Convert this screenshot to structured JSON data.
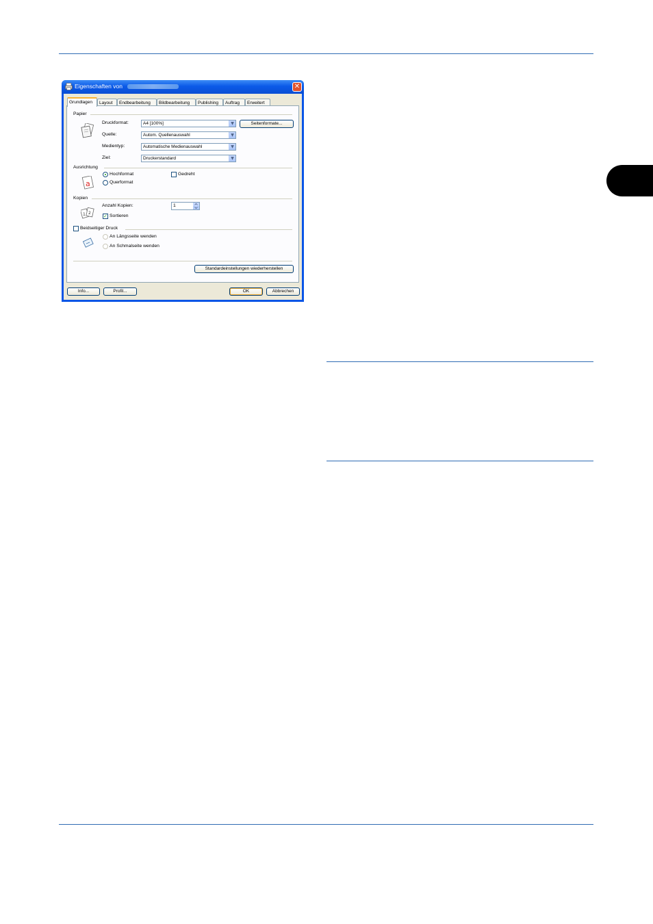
{
  "dialog": {
    "title": "Eigenschaften von",
    "close_glyph": "✕",
    "title_icon": "printer-icon",
    "tabs": [
      "Grundlagen",
      "Layout",
      "Endbearbeitung",
      "Bildbearbeitung",
      "Publishing",
      "Auftrag",
      "Erweitert"
    ],
    "active_tab": "Grundlagen",
    "papier": {
      "heading": "Papier",
      "druckformat_label": "Druckformat:",
      "druckformat_value": "A4  [100%]",
      "quelle_label": "Quelle:",
      "quelle_value": "Autom. Quellenauswahl",
      "medientyp_label": "Medientyp:",
      "medientyp_value": "Automatische Medienauswahl",
      "ziel_label": "Ziel:",
      "ziel_value": "Druckerstandard",
      "seitenformate_button": "Seitenformate..."
    },
    "ausrichtung": {
      "heading": "Ausrichtung",
      "hochformat": "Hochformat",
      "querformat": "Querformat",
      "gedreht": "Gedreht",
      "selected": "Hochformat"
    },
    "kopien": {
      "heading": "Kopien",
      "anzahl_label": "Anzahl Kopien:",
      "anzahl_value": "1",
      "sortieren": "Sortieren",
      "sortieren_checked": true
    },
    "duplex": {
      "heading": "Beidseitiger Druck",
      "laengsseite": "An Längsseite wenden",
      "schmalseite": "An Schmalseite wenden",
      "checked": false
    },
    "restore_button": "Standardeinstellungen wiederherstellen",
    "info_button": "Info...",
    "profil_button": "Profil...",
    "ok_button": "OK",
    "cancel_button": "Abbrechen"
  },
  "colors": {
    "rule": "#2f6bb3",
    "side_tab": "#000000",
    "dialog_frame": "#0a55e6"
  }
}
